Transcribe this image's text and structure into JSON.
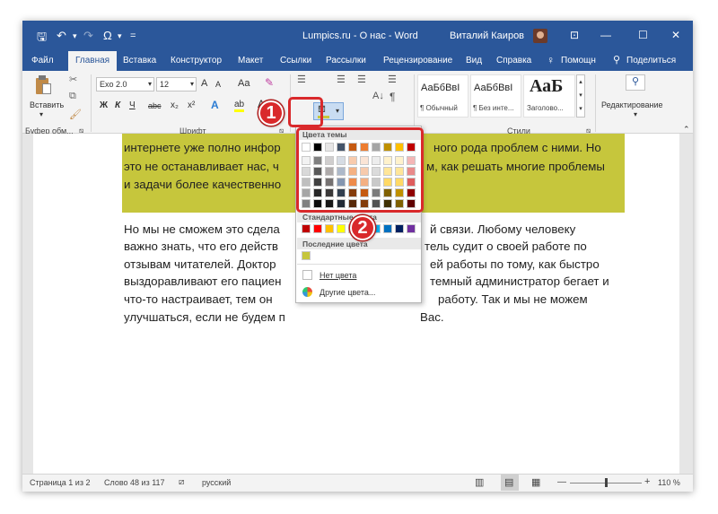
{
  "titlebar": {
    "doc_title": "Lumpics.ru - О нас  -  Word",
    "user_name": "Виталий Каиров",
    "qat": {
      "save": "🖫",
      "undo": "↶",
      "redo": "↷",
      "omega": "Ω",
      "more": "="
    },
    "window_controls": {
      "ribbon_display": "⊡",
      "minimize": "—",
      "maximize": "☐",
      "close": "✕"
    }
  },
  "tabs": [
    "Файл",
    "Главная",
    "Вставка",
    "Конструктор",
    "Макет",
    "Ссылки",
    "Рассылки",
    "Рецензирование",
    "Вид",
    "Справка"
  ],
  "help_search": "Помощн",
  "share": "Поделиться",
  "ribbon": {
    "clipboard": {
      "paste": "Вставить",
      "group": "Буфер обм..."
    },
    "font": {
      "font_name": "Exo 2.0",
      "font_size": "12",
      "grow": "A",
      "shrink": "A",
      "case": "Aa",
      "bold": "Ж",
      "italic": "К",
      "underline": "Ч",
      "strike": "abc",
      "subscript": "x₂",
      "superscript": "x²",
      "text_effects": "A",
      "highlight": "ab",
      "font_color": "A",
      "group": "Шрифт"
    },
    "paragraph": {
      "sort": "A↓",
      "pilcrow": "¶"
    },
    "styles": {
      "items": [
        {
          "preview": "АаБбВвІ",
          "name": "¶ Обычный"
        },
        {
          "preview": "АаБбВвІ",
          "name": "¶ Без инте..."
        },
        {
          "preview": "АаБ",
          "name": "Заголово..."
        }
      ],
      "group": "Стили"
    },
    "editing": {
      "label": "Редактирование"
    }
  },
  "document": {
    "highlighted_lines": [
      "интернете уже полно инфор",
      "ного рода проблем с ними. Но",
      "это не останавливает нас, ч",
      "м, как решать многие проблемы",
      "и задачи более качественно"
    ],
    "lines": [
      "Но мы не сможем это сдела",
      "й связи. Любому человеку",
      "важно знать, что его действ",
      "тель судит о своей работе по",
      "отзывам читателей. Доктор",
      "ей работы по тому, как быстро",
      "выздоравливают его пациен",
      "темный администратор бегает и",
      "что-то настраивает, тем он",
      "работу. Так и мы не можем",
      "улучшаться, если не будем п",
      "Вас."
    ]
  },
  "dropdown": {
    "theme_colors_header": "Цвета темы",
    "standard_colors_header": "Стандартные цвета",
    "recent_colors_header": "Последние цвета",
    "no_color": "Нет цвета",
    "more_colors": "Другие цвета...",
    "theme_top": [
      "#ffffff",
      "#000000",
      "#e7e6e6",
      "#44546a",
      "#c55a11",
      "#ed7d31",
      "#a5a5a5",
      "#bf9000",
      "#ffc000",
      "#c00000"
    ],
    "theme_shades": [
      [
        "#f2f2f2",
        "#808080",
        "#d0cece",
        "#d6dce4",
        "#f8cbad",
        "#fbe5d6",
        "#ededed",
        "#fff2cc",
        "#fff2cc",
        "#f4b6b6"
      ],
      [
        "#d9d9d9",
        "#595959",
        "#aeaaaa",
        "#adb9ca",
        "#f4b183",
        "#f7caac",
        "#dbdbdb",
        "#ffe699",
        "#ffe699",
        "#e98a8a"
      ],
      [
        "#bfbfbf",
        "#404040",
        "#757171",
        "#8496b0",
        "#ee8b4b",
        "#f4b083",
        "#c9c9c9",
        "#ffd966",
        "#ffd966",
        "#de5d5d"
      ],
      [
        "#a6a6a6",
        "#262626",
        "#3a3838",
        "#323f4f",
        "#843c0c",
        "#c55a11",
        "#7b7b7b",
        "#7f6000",
        "#bf9000",
        "#900000"
      ],
      [
        "#808080",
        "#0d0d0d",
        "#171616",
        "#222a35",
        "#582808",
        "#833c0b",
        "#525252",
        "#3f3000",
        "#7f6000",
        "#600000"
      ]
    ],
    "standard": [
      "#c00000",
      "#ff0000",
      "#ffc000",
      "#ffff00",
      "#92d050",
      "#00b050",
      "#00b0f0",
      "#0070c0",
      "#002060",
      "#7030a0"
    ],
    "recent": [
      "#c6c63c"
    ]
  },
  "callouts": {
    "one": "1",
    "two": "2"
  },
  "statusbar": {
    "page": "Страница 1 из 2",
    "words": "Слово 48 из 117",
    "language": "русский",
    "zoom": "110 %"
  }
}
